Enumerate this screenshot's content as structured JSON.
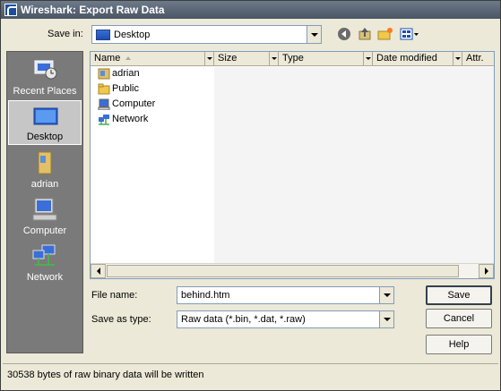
{
  "window": {
    "title": "Wireshark: Export Raw Data"
  },
  "save_in": {
    "label": "Save in:",
    "value": "Desktop"
  },
  "toolbar": {
    "icons": [
      "back-icon",
      "up-folder-icon",
      "new-folder-icon",
      "view-menu-icon"
    ]
  },
  "places": [
    {
      "label": "Recent Places",
      "icon": "recent-places-icon"
    },
    {
      "label": "Desktop",
      "icon": "desktop-icon"
    },
    {
      "label": "adrian",
      "icon": "user-folder-icon"
    },
    {
      "label": "Computer",
      "icon": "computer-icon"
    },
    {
      "label": "Network",
      "icon": "network-icon"
    }
  ],
  "columns": [
    "Name",
    "Size",
    "Type",
    "Date modified",
    "Attr."
  ],
  "files": [
    {
      "name": "adrian",
      "icon": "user-folder-icon"
    },
    {
      "name": "Public",
      "icon": "folder-icon"
    },
    {
      "name": "Computer",
      "icon": "computer-icon"
    },
    {
      "name": "Network",
      "icon": "network-icon"
    }
  ],
  "file_name": {
    "label": "File name:",
    "value": "behind.htm"
  },
  "save_as_type": {
    "label": "Save as type:",
    "value": "Raw data (*.bin, *.dat, *.raw)"
  },
  "buttons": {
    "save": "Save",
    "cancel": "Cancel",
    "help": "Help"
  },
  "status": "30538 bytes of raw binary data will be written"
}
